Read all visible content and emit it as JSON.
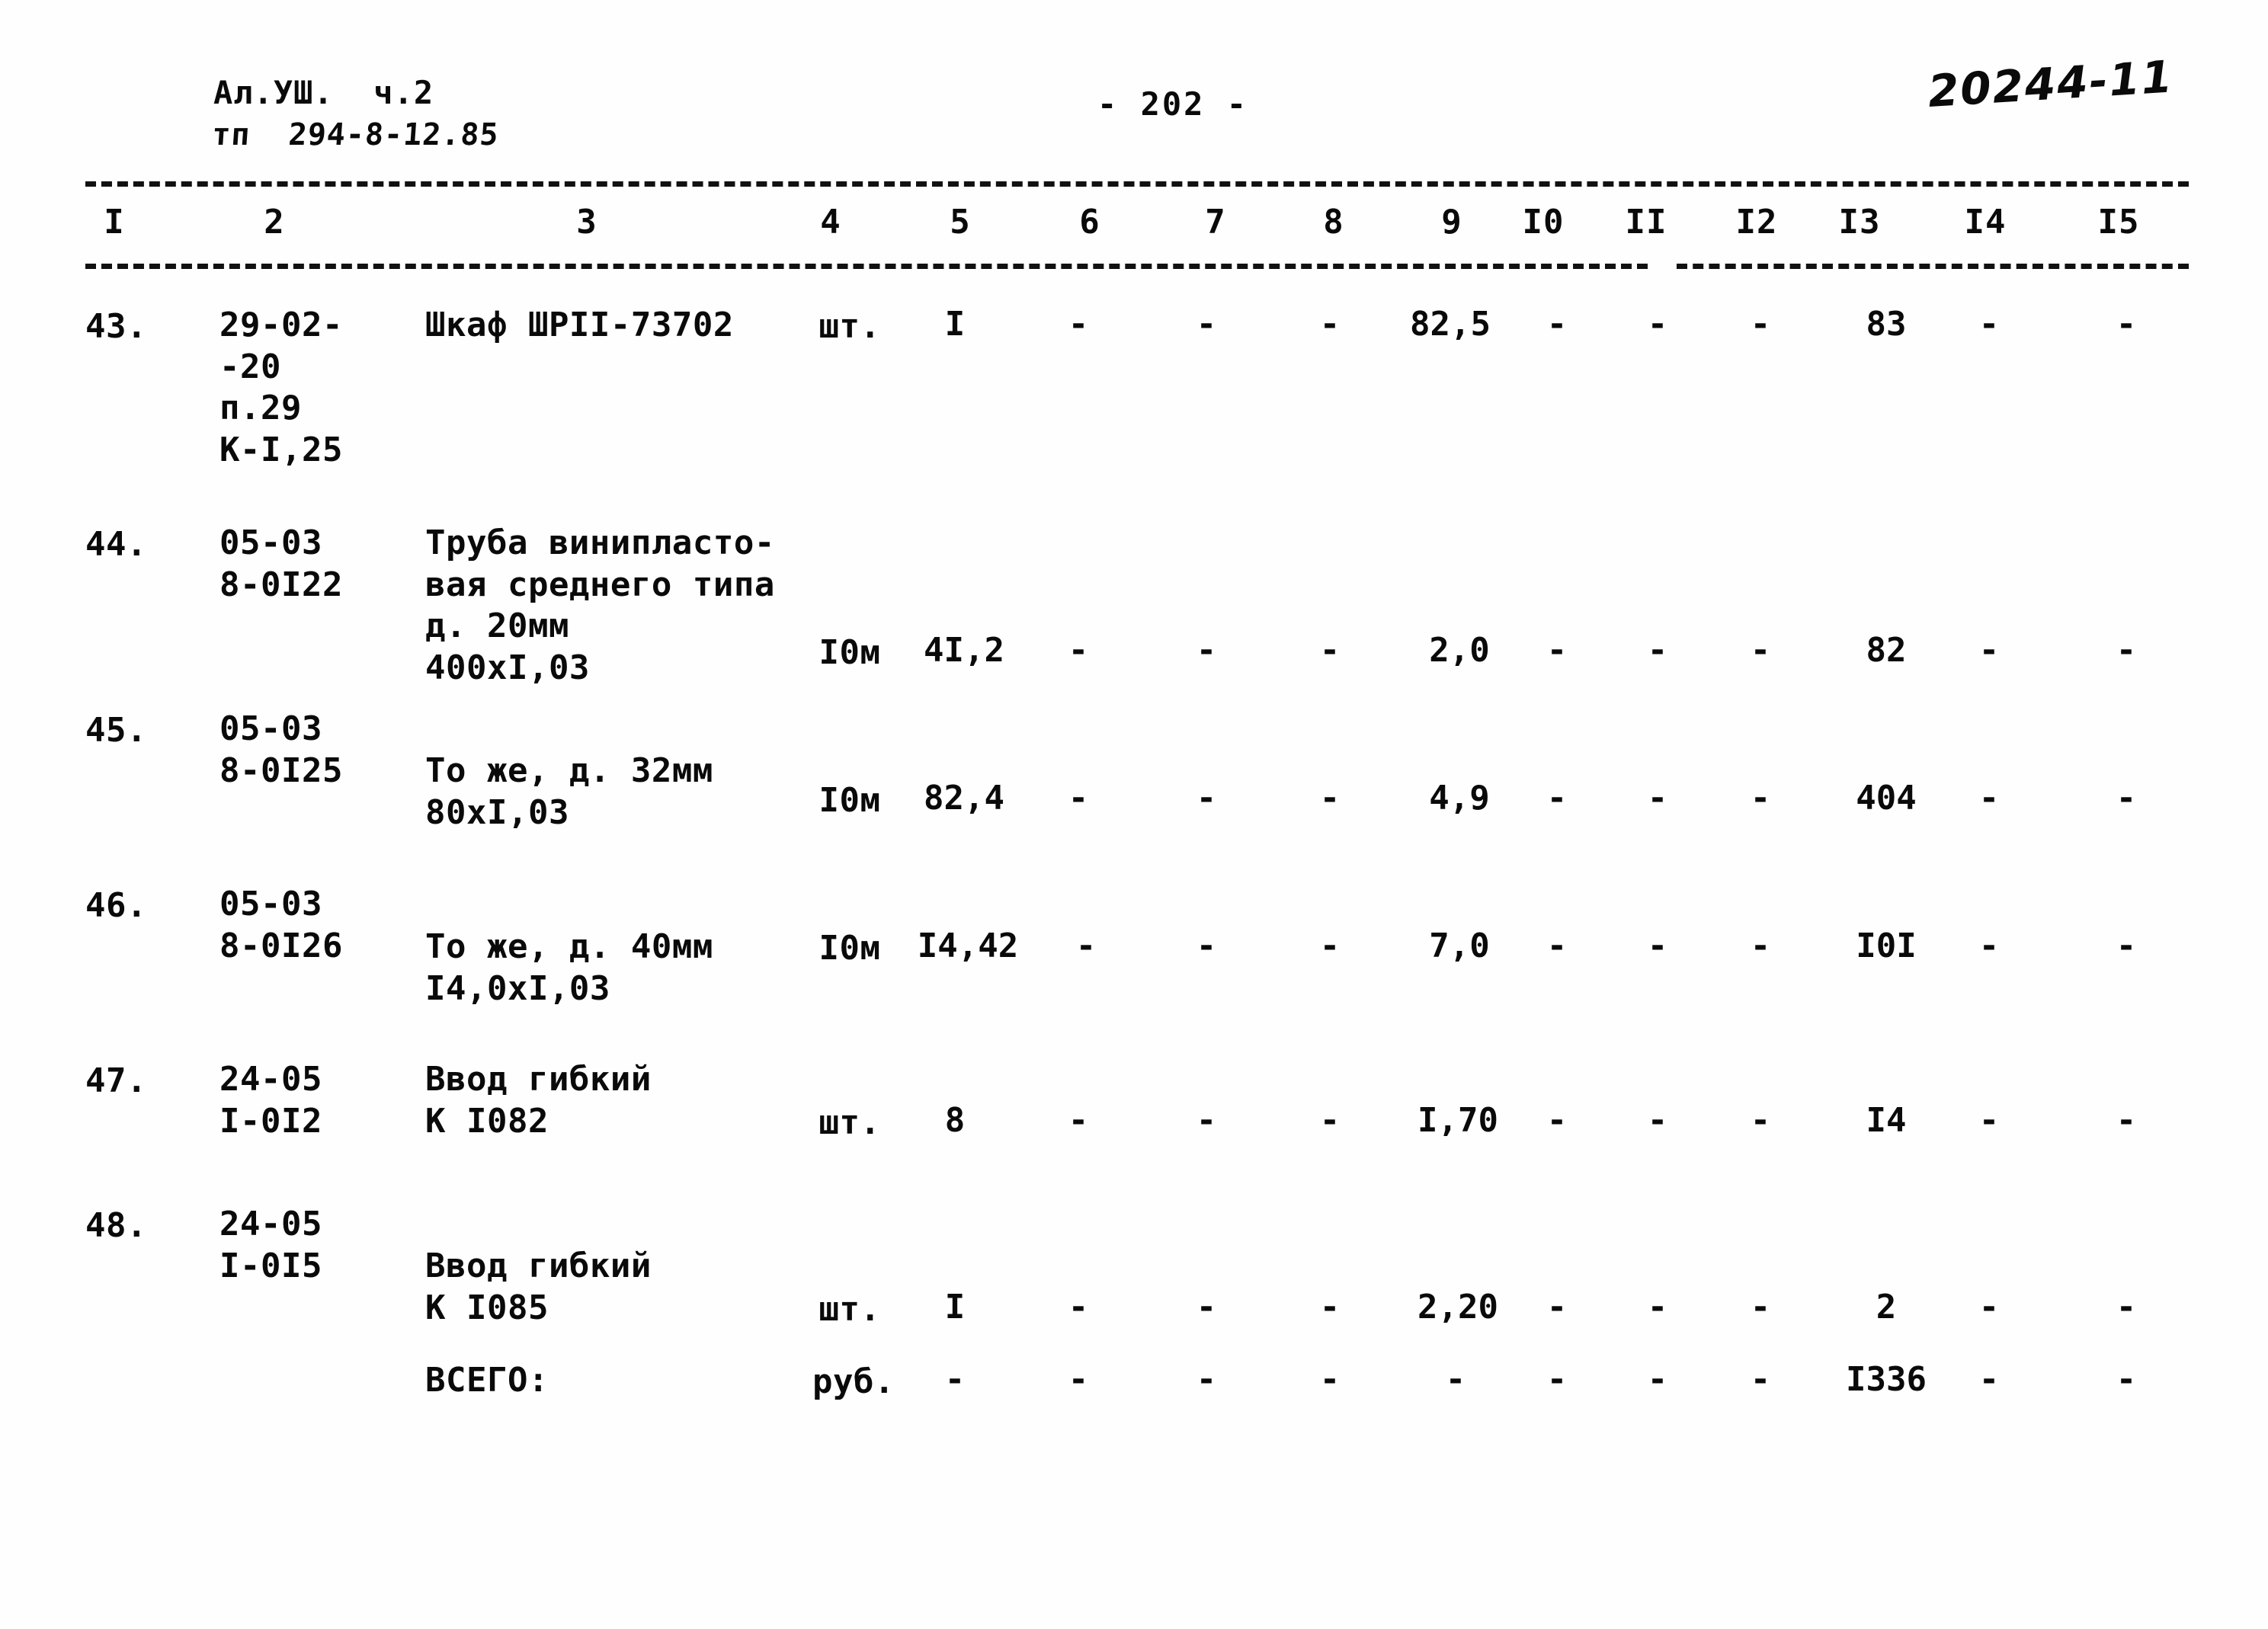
{
  "header": {
    "album_line": "Ал.УШ.  ч.2",
    "project_line": "тп  294-8-12.85",
    "page_number": "- 202 -",
    "doc_code": "20244-11"
  },
  "table": {
    "column_numbers": [
      "I",
      "2",
      "3",
      "4",
      "5",
      "6",
      "7",
      "8",
      "9",
      "I0",
      "II",
      "I2",
      "I3",
      "I4",
      "I5"
    ],
    "rows": [
      {
        "no": "43.",
        "code": "29-02-\n-20\nп.29\nК-I,25",
        "name": "Шкаф ШРII-73702",
        "unit": "шт.",
        "c5": "I",
        "c6": "-",
        "c7": "-",
        "c8": "-",
        "c9": "82,5",
        "c10": "-",
        "c11": "-",
        "c12": "-",
        "c13": "83",
        "c14": "-",
        "c15": "-"
      },
      {
        "no": "44.",
        "code": "05-03\n8-0I22",
        "name": "Труба винипласто-\nвая среднего типа\nд. 20мм\n400хI,03",
        "unit": "I0м",
        "c5": "4I,2",
        "c6": "-",
        "c7": "-",
        "c8": "-",
        "c9": "2,0",
        "c10": "-",
        "c11": "-",
        "c12": "-",
        "c13": "82",
        "c14": "-",
        "c15": "-"
      },
      {
        "no": "45.",
        "code": "05-03\n8-0I25",
        "name": "То же, д. 32мм\n80хI,03",
        "unit": "I0м",
        "c5": "82,4",
        "c6": "-",
        "c7": "-",
        "c8": "-",
        "c9": "4,9",
        "c10": "-",
        "c11": "-",
        "c12": "-",
        "c13": "404",
        "c14": "-",
        "c15": "-"
      },
      {
        "no": "46.",
        "code": "05-03\n8-0I26",
        "name": "То же, д. 40мм\nI4,0хI,03",
        "unit": "I0м",
        "c5": "I4,42",
        "c6": "-",
        "c7": "-",
        "c8": "-",
        "c9": "7,0",
        "c10": "-",
        "c11": "-",
        "c12": "-",
        "c13": "I0I",
        "c14": "-",
        "c15": "-"
      },
      {
        "no": "47.",
        "code": "24-05\nI-0I2",
        "name": "Ввод гибкий\nК I082",
        "unit": "шт.",
        "c5": "8",
        "c6": "-",
        "c7": "-",
        "c8": "-",
        "c9": "I,70",
        "c10": "-",
        "c11": "-",
        "c12": "-",
        "c13": "I4",
        "c14": "-",
        "c15": "-"
      },
      {
        "no": "48.",
        "code": "24-05\nI-0I5",
        "name": "Ввод гибкий\nК I085",
        "unit": "шт.",
        "c5": "I",
        "c6": "-",
        "c7": "-",
        "c8": "-",
        "c9": "2,20",
        "c10": "-",
        "c11": "-",
        "c12": "-",
        "c13": "2",
        "c14": "-",
        "c15": "-"
      }
    ],
    "total_row": {
      "label": "ВСЕГО:",
      "unit": "руб.",
      "c5": "-",
      "c6": "-",
      "c7": "-",
      "c8": "-",
      "c9": "-",
      "c10": "-",
      "c11": "-",
      "c12": "-",
      "c13": "I336",
      "c14": "-",
      "c15": "-"
    }
  }
}
